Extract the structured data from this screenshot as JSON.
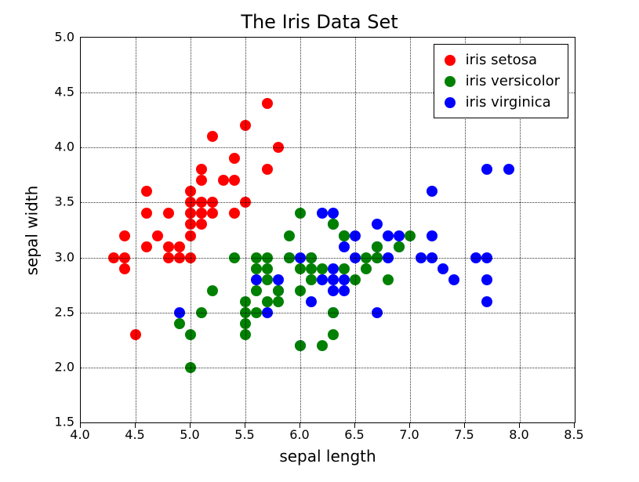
{
  "chart_data": {
    "type": "scatter",
    "title": "The Iris Data Set",
    "xlabel": "sepal length",
    "ylabel": "sepal width",
    "xlim": [
      4.0,
      8.5
    ],
    "ylim": [
      1.5,
      5.0
    ],
    "xticks": [
      4.0,
      4.5,
      5.0,
      5.5,
      6.0,
      6.5,
      7.0,
      7.5,
      8.0,
      8.5
    ],
    "yticks": [
      1.5,
      2.0,
      2.5,
      3.0,
      3.5,
      4.0,
      4.5,
      5.0
    ],
    "series": [
      {
        "name": "iris setosa",
        "color": "#ff0000",
        "points": [
          [
            4.3,
            3.0
          ],
          [
            4.4,
            2.9
          ],
          [
            4.4,
            3.0
          ],
          [
            4.4,
            3.2
          ],
          [
            4.5,
            2.3
          ],
          [
            4.6,
            3.1
          ],
          [
            4.6,
            3.4
          ],
          [
            4.6,
            3.6
          ],
          [
            4.7,
            3.2
          ],
          [
            4.8,
            3.0
          ],
          [
            4.8,
            3.1
          ],
          [
            4.8,
            3.4
          ],
          [
            4.9,
            3.0
          ],
          [
            4.9,
            3.1
          ],
          [
            5.0,
            3.0
          ],
          [
            5.0,
            3.2
          ],
          [
            5.0,
            3.3
          ],
          [
            5.0,
            3.4
          ],
          [
            5.0,
            3.5
          ],
          [
            5.0,
            3.6
          ],
          [
            5.1,
            3.3
          ],
          [
            5.1,
            3.4
          ],
          [
            5.1,
            3.5
          ],
          [
            5.1,
            3.7
          ],
          [
            5.1,
            3.8
          ],
          [
            5.2,
            3.4
          ],
          [
            5.2,
            3.5
          ],
          [
            5.2,
            4.1
          ],
          [
            5.3,
            3.7
          ],
          [
            5.4,
            3.4
          ],
          [
            5.4,
            3.7
          ],
          [
            5.4,
            3.9
          ],
          [
            5.5,
            3.5
          ],
          [
            5.5,
            4.2
          ],
          [
            5.7,
            3.8
          ],
          [
            5.7,
            4.4
          ],
          [
            5.8,
            4.0
          ]
        ]
      },
      {
        "name": "iris versicolor",
        "color": "#008000",
        "points": [
          [
            4.9,
            2.4
          ],
          [
            5.0,
            2.0
          ],
          [
            5.0,
            2.3
          ],
          [
            5.1,
            2.5
          ],
          [
            5.2,
            2.7
          ],
          [
            5.4,
            3.0
          ],
          [
            5.5,
            2.3
          ],
          [
            5.5,
            2.4
          ],
          [
            5.5,
            2.5
          ],
          [
            5.5,
            2.6
          ],
          [
            5.6,
            2.5
          ],
          [
            5.6,
            2.7
          ],
          [
            5.6,
            2.9
          ],
          [
            5.6,
            3.0
          ],
          [
            5.7,
            2.6
          ],
          [
            5.7,
            2.8
          ],
          [
            5.7,
            2.9
          ],
          [
            5.7,
            3.0
          ],
          [
            5.8,
            2.6
          ],
          [
            5.8,
            2.7
          ],
          [
            5.9,
            3.0
          ],
          [
            5.9,
            3.2
          ],
          [
            6.0,
            2.2
          ],
          [
            6.0,
            2.7
          ],
          [
            6.0,
            2.9
          ],
          [
            6.0,
            3.4
          ],
          [
            6.1,
            2.8
          ],
          [
            6.1,
            2.9
          ],
          [
            6.1,
            3.0
          ],
          [
            6.2,
            2.2
          ],
          [
            6.2,
            2.9
          ],
          [
            6.3,
            2.3
          ],
          [
            6.3,
            2.5
          ],
          [
            6.3,
            3.3
          ],
          [
            6.4,
            2.9
          ],
          [
            6.4,
            3.2
          ],
          [
            6.5,
            2.8
          ],
          [
            6.6,
            2.9
          ],
          [
            6.6,
            3.0
          ],
          [
            6.7,
            3.0
          ],
          [
            6.7,
            3.1
          ],
          [
            6.8,
            2.8
          ],
          [
            6.9,
            3.1
          ],
          [
            7.0,
            3.2
          ]
        ]
      },
      {
        "name": "iris virginica",
        "color": "#0000ff",
        "points": [
          [
            4.9,
            2.5
          ],
          [
            5.6,
            2.8
          ],
          [
            5.7,
            2.5
          ],
          [
            5.8,
            2.7
          ],
          [
            5.8,
            2.8
          ],
          [
            5.9,
            3.0
          ],
          [
            6.0,
            2.2
          ],
          [
            6.0,
            3.0
          ],
          [
            6.1,
            2.6
          ],
          [
            6.1,
            3.0
          ],
          [
            6.2,
            2.8
          ],
          [
            6.2,
            3.4
          ],
          [
            6.3,
            2.5
          ],
          [
            6.3,
            2.7
          ],
          [
            6.3,
            2.8
          ],
          [
            6.3,
            2.9
          ],
          [
            6.3,
            3.3
          ],
          [
            6.3,
            3.4
          ],
          [
            6.4,
            2.7
          ],
          [
            6.4,
            2.8
          ],
          [
            6.4,
            3.1
          ],
          [
            6.4,
            3.2
          ],
          [
            6.5,
            3.0
          ],
          [
            6.5,
            3.2
          ],
          [
            6.7,
            2.5
          ],
          [
            6.7,
            3.0
          ],
          [
            6.7,
            3.1
          ],
          [
            6.7,
            3.3
          ],
          [
            6.8,
            3.0
          ],
          [
            6.8,
            3.2
          ],
          [
            6.9,
            3.1
          ],
          [
            6.9,
            3.2
          ],
          [
            7.1,
            3.0
          ],
          [
            7.2,
            3.0
          ],
          [
            7.2,
            3.2
          ],
          [
            7.2,
            3.6
          ],
          [
            7.3,
            2.9
          ],
          [
            7.4,
            2.8
          ],
          [
            7.6,
            3.0
          ],
          [
            7.7,
            2.6
          ],
          [
            7.7,
            2.8
          ],
          [
            7.7,
            3.0
          ],
          [
            7.7,
            3.8
          ],
          [
            7.9,
            3.8
          ]
        ]
      }
    ]
  }
}
